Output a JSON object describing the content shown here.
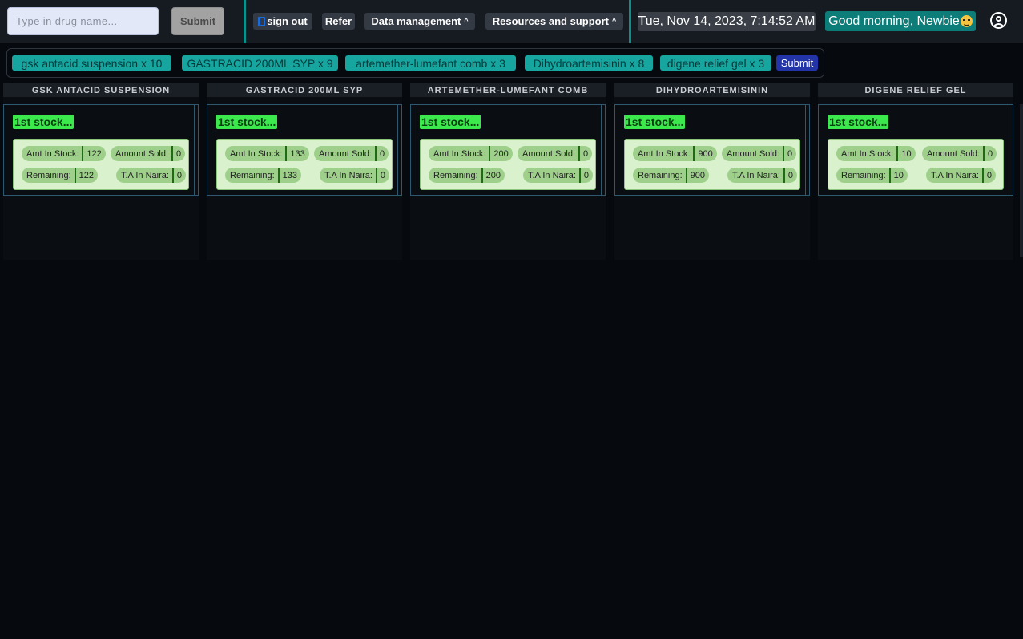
{
  "search": {
    "placeholder": "Type in drug name...",
    "submit_label": "Submit"
  },
  "nav": {
    "sign_out_label": "sign out",
    "refer_label": "Refer",
    "data_management_label": "Data management",
    "resources_label": "Resources and support"
  },
  "datetime": "Tue, Nov 14, 2023, 7:14:52 AM",
  "greeting": "Good morning, Newbie",
  "cart": {
    "items": [
      "gsk antacid suspension x 10",
      "GASTRACID 200ML SYP x 9",
      "artemether-lumefant comb x 3",
      "Dihydroartemisinin x 8",
      "digene relief gel x 3"
    ],
    "submit_label": "Submit"
  },
  "labels": {
    "stock_title": "1st stock...",
    "amt_in_stock": "Amt In Stock:",
    "amount_sold": "Amount Sold:",
    "remaining": "Remaining:",
    "ta_in_naira": "T.A In Naira:"
  },
  "drugs": [
    {
      "name": "GSK ANTACID SUSPENSION",
      "amt_in_stock": "122",
      "amount_sold": "0",
      "remaining": "122",
      "ta_in_naira": "0"
    },
    {
      "name": "GASTRACID 200ML SYP",
      "amt_in_stock": "133",
      "amount_sold": "0",
      "remaining": "133",
      "ta_in_naira": "0"
    },
    {
      "name": "ARTEMETHER-LUMEFANT COMB",
      "amt_in_stock": "200",
      "amount_sold": "0",
      "remaining": "200",
      "ta_in_naira": "0"
    },
    {
      "name": "DIHYDROARTEMISININ",
      "amt_in_stock": "900",
      "amount_sold": "0",
      "remaining": "900",
      "ta_in_naira": "0"
    },
    {
      "name": "DIGENE RELIEF GEL",
      "amt_in_stock": "10",
      "amount_sold": "0",
      "remaining": "10",
      "ta_in_naira": "0"
    }
  ]
}
